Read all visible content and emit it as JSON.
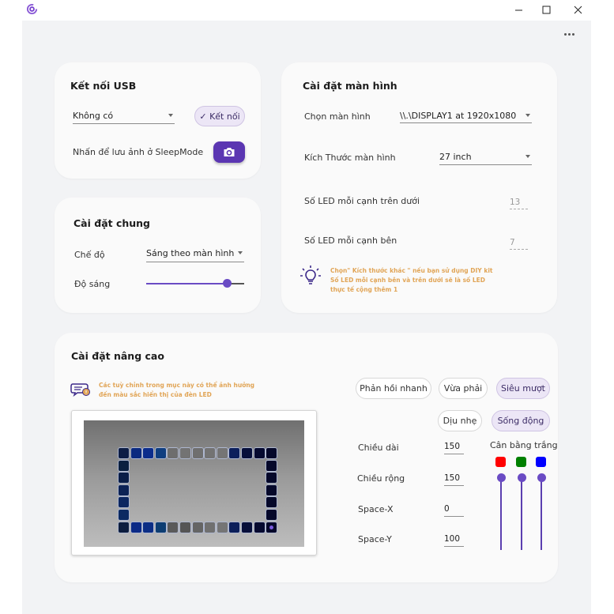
{
  "window": {
    "logo_icon": "app-ring-logo-icon",
    "minimize_icon": "minimize-icon",
    "maximize_icon": "maximize-icon",
    "close_icon": "close-icon",
    "more_icon": "more-dots-icon"
  },
  "usb": {
    "title": "Kết nối USB",
    "port_value": "Không có",
    "connect_label": "✓ Kết nối",
    "sleep_label": "Nhấn để lưu ảnh ở SleepMode",
    "camera_icon": "camera-icon"
  },
  "general": {
    "title": "Cài đặt chung",
    "mode_label": "Chế độ",
    "mode_value": "Sáng theo màn hình",
    "brightness_label": "Độ sáng",
    "brightness_value_percent": 86
  },
  "display": {
    "title": "Cài đặt màn hình",
    "monitor_label": "Chọn màn hình",
    "monitor_value": "\\\\.\\DISPLAY1 at 1920x1080",
    "size_label": "Kích Thước màn hình",
    "size_value": "27 inch",
    "led_top_bottom_label": "Số LED mỗi cạnh trên dưới",
    "led_top_bottom_value": "13",
    "led_side_label": "Số LED mỗi cạnh bên",
    "led_side_value": "7",
    "hint_icon": "lightbulb-icon",
    "hint_lines": [
      "Chọn\" Kích thước khác \" nếu bạn sử dụng DIY kit",
      "Số LED mỗi cạnh bên và trên dưới sẽ là số LED",
      "thực tế cộng thêm 1"
    ]
  },
  "advanced": {
    "title": "Cài đặt nâng cao",
    "warn_icon": "chat-warning-icon",
    "warn_lines": [
      "Các tuỳ chỉnh trong mục này có thể ảnh hưởng",
      "đến màu sắc hiển thị của đèn LED"
    ],
    "response_chips": [
      {
        "label": "Phản hồi nhanh",
        "selected": false
      },
      {
        "label": "Vừa phải",
        "selected": false
      },
      {
        "label": "Siêu mượt",
        "selected": true
      }
    ],
    "color_chips": [
      {
        "label": "Dịu nhẹ",
        "selected": false
      },
      {
        "label": "Sống động",
        "selected": true
      }
    ],
    "fields": [
      {
        "label": "Chiều dài",
        "value": "150"
      },
      {
        "label": "Chiều rộng",
        "value": "150"
      },
      {
        "label": "Space-X",
        "value": "0"
      },
      {
        "label": "Space-Y",
        "value": "100"
      }
    ],
    "white_balance": {
      "label": "Cân bằng trắng",
      "channels": [
        {
          "name": "red",
          "color": "#ff0000",
          "value_percent": 100
        },
        {
          "name": "green",
          "color": "#008000",
          "value_percent": 100
        },
        {
          "name": "blue",
          "color": "#0000ff",
          "value_percent": 100
        }
      ]
    },
    "led_preview": {
      "top": [
        "#0d1d45",
        "#0b2a80",
        "#0c2d8c",
        "#0f3e80",
        "#6e6e6e",
        "#737373",
        "#6f6f6f",
        "#737373",
        "#757575",
        "#0c1f5c",
        "#070f3a",
        "#060a30",
        "#05082a"
      ],
      "bottom": [
        "#0d1d3e",
        "#0b2a86",
        "#0c2e85",
        "#0d3d72",
        "#5a5a5a",
        "#555555",
        "#656565",
        "#707070",
        "#757575",
        "#0c1f5a",
        "#070f3a",
        "#060a30",
        "#05082a"
      ],
      "left": [
        "#0b2040",
        "#0b1e48",
        "#0c2255",
        "#0c2660",
        "#0c2a62"
      ],
      "right": [
        "#05082a",
        "#05082a",
        "#05082a",
        "#05082a",
        "#05082a"
      ]
    }
  }
}
